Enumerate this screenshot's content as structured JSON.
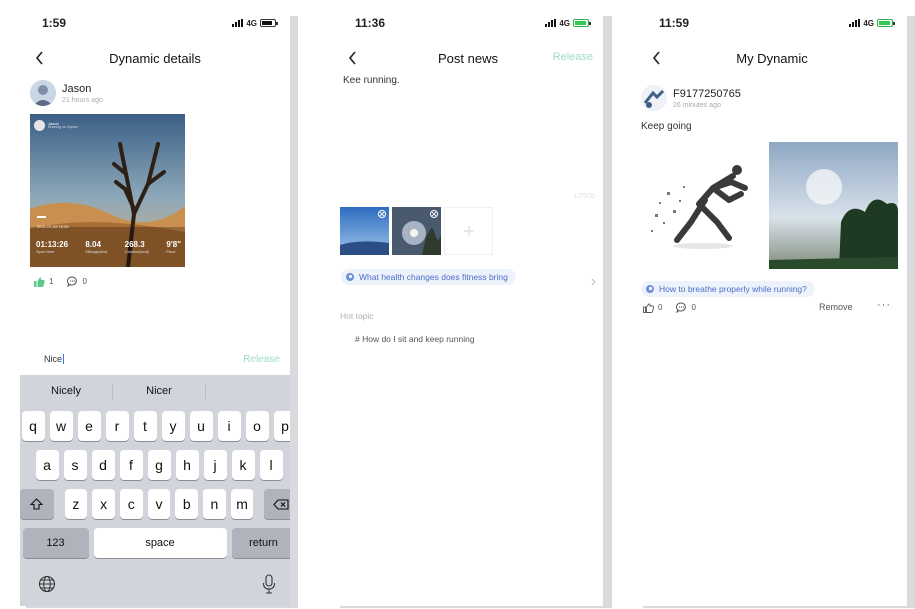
{
  "screen1": {
    "time": "1:59",
    "network": "4G",
    "title": "Dynamic details",
    "user_name": "Jason",
    "user_time": "21 hours ago",
    "photo": {
      "header_name": "Jason",
      "header_sub": "Running on Gymax",
      "date": "2021-01-08 16:05",
      "stats": [
        {
          "value": "01:13:26",
          "label": "Sport time"
        },
        {
          "value": "8.04",
          "label": "Mileage(km)"
        },
        {
          "value": "268.3",
          "label": "Calories(kcal)"
        },
        {
          "value": "9'8\"",
          "label": "Pace"
        }
      ]
    },
    "likes": "1",
    "comments": "0",
    "input_value": "Nice",
    "release_label": "Release",
    "keyboard": {
      "suggestions": [
        "Nicely",
        "Nicer",
        ""
      ],
      "row1": [
        "q",
        "w",
        "e",
        "r",
        "t",
        "y",
        "u",
        "i",
        "o",
        "p"
      ],
      "row2": [
        "a",
        "s",
        "d",
        "f",
        "g",
        "h",
        "j",
        "k",
        "l"
      ],
      "row3": [
        "z",
        "x",
        "c",
        "v",
        "b",
        "n",
        "m"
      ],
      "numbers_label": "123",
      "space_label": "space",
      "return_label": "return"
    }
  },
  "screen2": {
    "time": "11:36",
    "network": "4G",
    "title": "Post news",
    "release_label": "Release",
    "body_text": "Kee running.",
    "char_count": "12/500",
    "topic": "What health changes does fitness bring",
    "hot_topic_label": "Hot topic",
    "hot_topic_item": "# How do I sit and keep running"
  },
  "screen3": {
    "time": "11:59",
    "network": "4G",
    "title": "My Dynamic",
    "user_name": "F9177250765",
    "user_time": "26 minutes ago",
    "post_text": "Keep going",
    "topic": "How to breathe properly while running?",
    "likes": "0",
    "comments": "0",
    "remove_label": "Remove",
    "more_label": "···"
  },
  "colors": {
    "accent_green": "#9fdcc1",
    "topic_blue": "#4b6fc8",
    "like_green": "#5cc98a",
    "keyboard_bg": "#d1d4db"
  }
}
